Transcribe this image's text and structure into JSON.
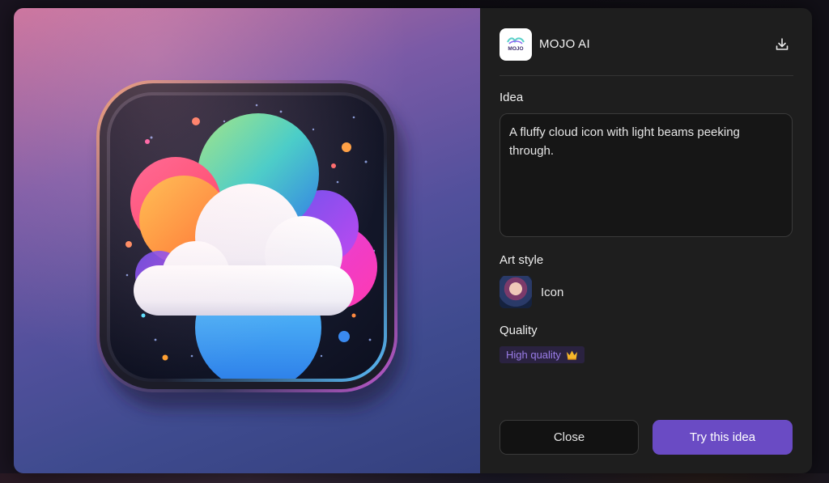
{
  "brand": {
    "name": "MOJO AI",
    "logo_text": "MOJO"
  },
  "header": {
    "download_icon": "download-icon"
  },
  "idea": {
    "label": "Idea",
    "text": "A fluffy cloud icon with light beams peeking through."
  },
  "art_style": {
    "label": "Art style",
    "value": "Icon"
  },
  "quality": {
    "label": "Quality",
    "badge": "High quality",
    "badge_icon": "crown-icon"
  },
  "buttons": {
    "close": "Close",
    "try": "Try this idea"
  },
  "colors": {
    "accent": "#6a4bc4",
    "badge_text": "#9a7de8",
    "panel_bg": "#1e1e1e"
  }
}
